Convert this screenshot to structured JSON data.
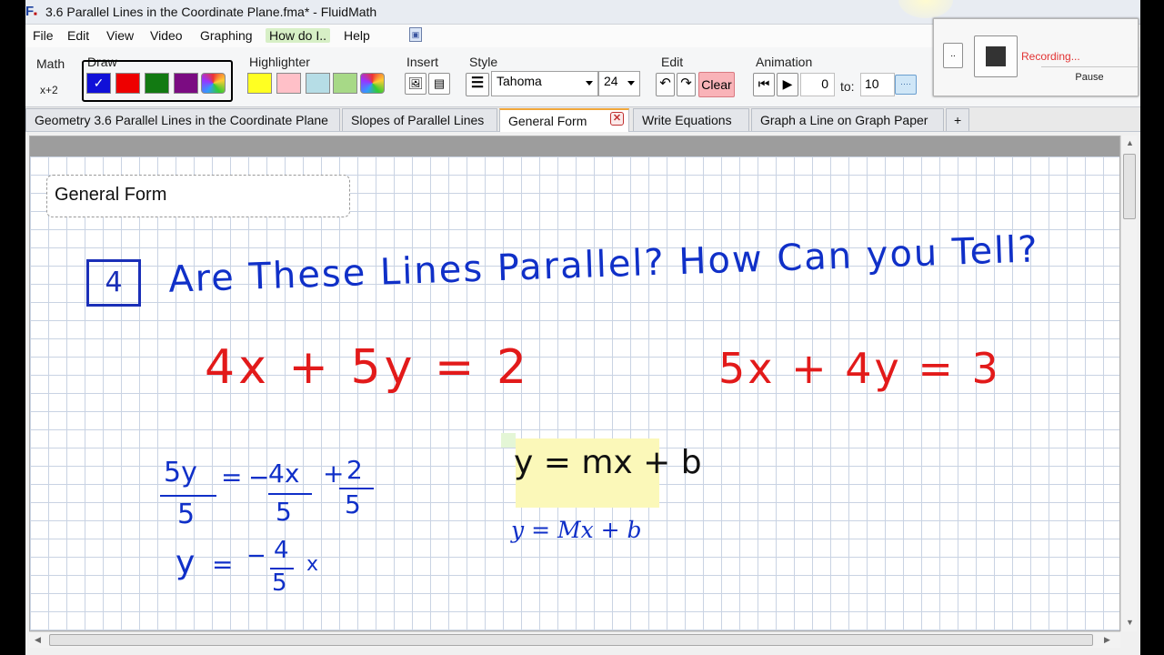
{
  "window": {
    "title": "3.6 Parallel Lines in the Coordinate Plane.fma* - FluidMath",
    "app_icon_letter": "F"
  },
  "menu": [
    "File",
    "Edit",
    "View",
    "Video",
    "Graphing",
    "How do I..",
    "Help"
  ],
  "ribbon": {
    "math_label": "Math",
    "math_sub": "x+2",
    "draw_label": "Draw",
    "draw_colors": [
      "#1010d8",
      "#ee0000",
      "#127a12",
      "#7b0c82"
    ],
    "highlighter_label": "Highlighter",
    "highlighter_colors": [
      "#ffff22",
      "#ffc0c8",
      "#b6dde6",
      "#a7d987"
    ],
    "insert_label": "Insert",
    "style_label": "Style",
    "font_name": "Tahoma",
    "font_size": "24",
    "edit_label": "Edit",
    "clear_label": "Clear",
    "animation_label": "Animation",
    "anim_from": "0",
    "anim_to_label": "to:",
    "anim_to": "10",
    "more_label": "····"
  },
  "recording": {
    "button_label": "..",
    "status": "Recording...",
    "pause_label": "Pause"
  },
  "tabs": [
    "Geometry 3.6  Parallel Lines in the Coordinate Plane",
    "Slopes of Parallel Lines",
    "General Form",
    "Write Equations",
    "Graph a Line on Graph Paper",
    "+"
  ],
  "active_tab_index": 2,
  "page": {
    "title_box": "General Form",
    "problem_number": "4",
    "question": "Are These Lines Parallel? How Can you Tell?",
    "equation_1": "4x + 5y = 2",
    "equation_2": "5x + 4y = 3",
    "work": {
      "line1_lhs_num": "5y",
      "line1_lhs_den": "5",
      "line1_eq": "=",
      "line1_term1_sign": "−",
      "line1_term1_num": "4x",
      "line1_term1_den": "5",
      "line1_term2_sign": "+",
      "line1_term2_num": "2",
      "line1_term2_den": "5",
      "line2_lhs": "y",
      "line2_eq": "=",
      "line2_sign": "−",
      "line2_num": "4",
      "line2_den": "5",
      "line2_tail": "x"
    },
    "slope_handwritten": "y = mx + b",
    "slope_typeset": "y = Mx + b"
  }
}
